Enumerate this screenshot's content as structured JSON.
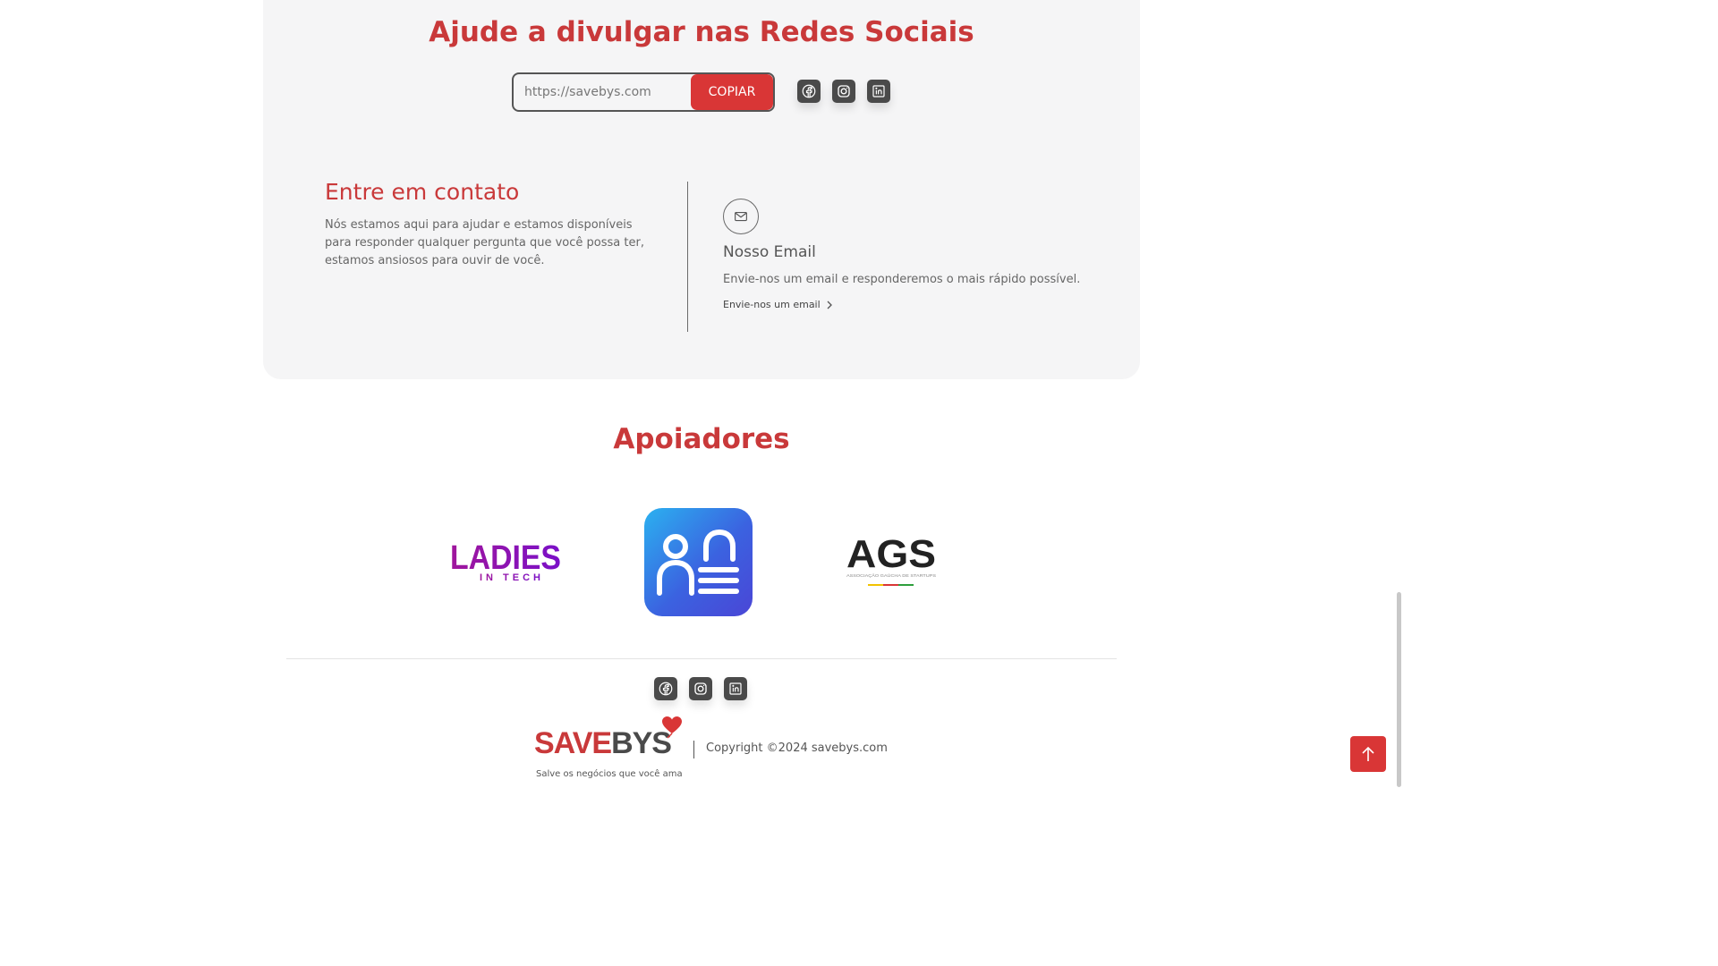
{
  "share": {
    "title": "Ajude a divulgar nas Redes Sociais",
    "url_value": "https://savebys.com",
    "copy_label": "COPIAR",
    "socials": [
      "facebook-icon",
      "instagram-icon",
      "linkedin-icon"
    ]
  },
  "contact": {
    "title": "Entre em contato",
    "text": "Nós estamos aqui para ajudar e estamos disponíveis para responder qualquer pergunta que você possa ter, estamos ansiosos para ouvir de você.",
    "email_icon": "mail-icon",
    "email_title": "Nosso Email",
    "email_text": "Envie-nos um email e responderemos o mais rápido possível.",
    "email_link": "Envie-nos um email"
  },
  "supporters": {
    "title": "Apoiadores",
    "logos": [
      {
        "name": "Ladies in Tech",
        "line1": "LADIES",
        "line2": "IN TECH"
      },
      {
        "name": "app-logo"
      },
      {
        "name": "AGS",
        "line1": "AGS",
        "line2": "ASSOCIAÇÃO GAÚCHA DE STARTUPS"
      }
    ]
  },
  "footer": {
    "brand_save": "SAVE",
    "brand_bys": "BYS",
    "brand_tagline": "Salve os negócios que você ama",
    "copyright": "Copyright ©2024 savebys.com",
    "socials": [
      "facebook-icon",
      "instagram-icon",
      "linkedin-icon"
    ]
  },
  "colors": {
    "accent": "#c9393a",
    "button": "#d93636",
    "card_bg": "#f5f5f6",
    "icon_bg": "#4a4a4a"
  }
}
